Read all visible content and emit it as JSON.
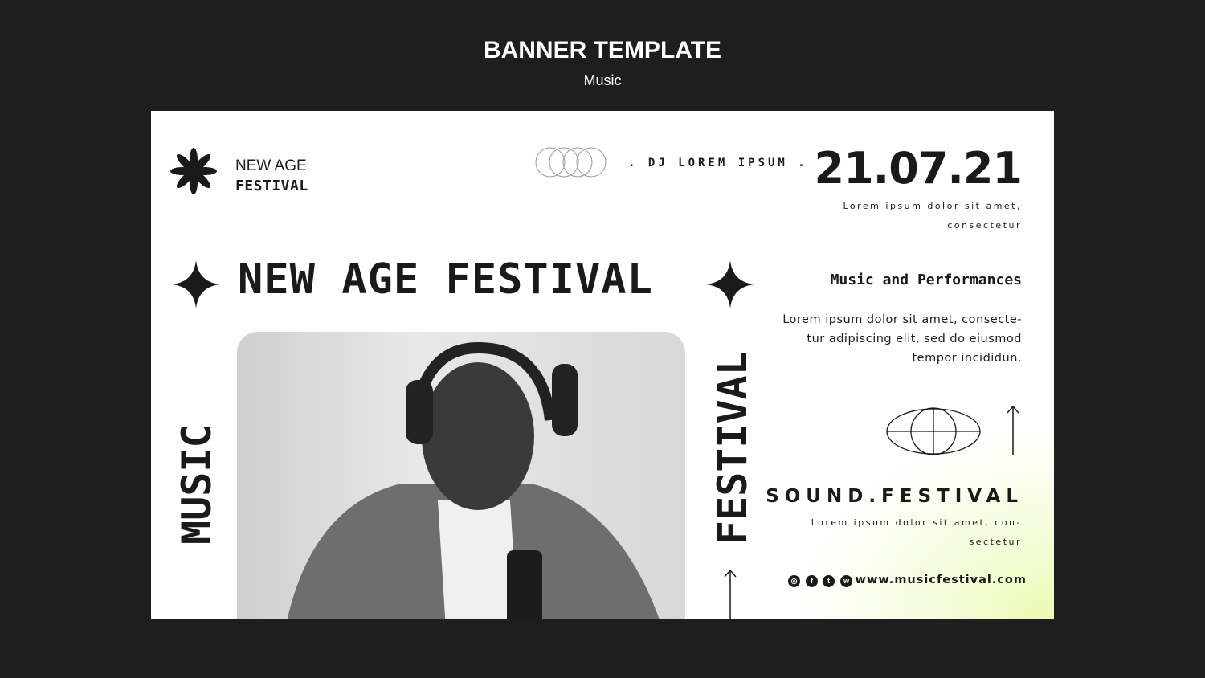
{
  "header": {
    "title": "BANNER TEMPLATE",
    "subtitle": "Music"
  },
  "banner": {
    "brand": {
      "line1": "NEW AGE",
      "line2": "FESTIVAL"
    },
    "dj": ". DJ LOREM IPSUM .",
    "date": "21.07.21",
    "date_text": {
      "line1": "Lorem ipsum dolor sit amet,",
      "line2": "consectetur"
    },
    "headline": "NEW AGE FESTIVAL",
    "vertical_left": "MUSIC",
    "vertical_right": "FESTIVAL",
    "section_title": "Music and Performances",
    "section_text": "Lorem ipsum dolor sit amet, consecte-tur adipiscing elit, sed do eiusmod tempor incididun.",
    "sound_title": "SOUND.FESTIVAL",
    "sound_text": {
      "line1": "Lorem ipsum dolor sit amet, con-",
      "line2": "sectetur"
    },
    "socials": [
      "instagram-icon",
      "facebook-icon",
      "twitter-icon",
      "whatsapp-icon"
    ],
    "url": "www.musicfestival.com",
    "accent": "#eafbb0"
  }
}
